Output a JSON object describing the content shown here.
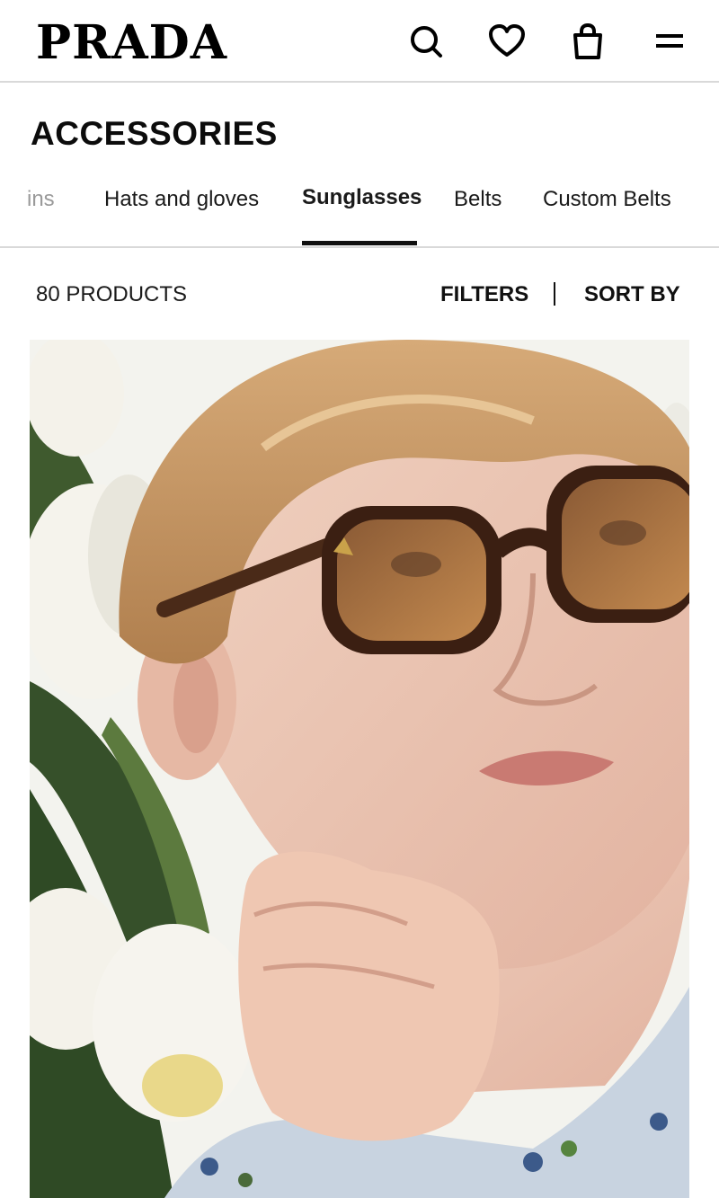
{
  "header": {
    "logo": "PRADA",
    "icons": [
      "search-icon",
      "heart-icon",
      "shopping-bag-icon",
      "menu-icon"
    ]
  },
  "category": {
    "title": "ACCESSORIES"
  },
  "tabs": [
    {
      "label": "ins",
      "state": "partially-hidden"
    },
    {
      "label": "Hats and gloves",
      "state": "default"
    },
    {
      "label": "Sunglasses",
      "state": "active"
    },
    {
      "label": "Belts",
      "state": "default"
    },
    {
      "label": "Custom Belts",
      "state": "default"
    }
  ],
  "results": {
    "count": "80 PRODUCTS",
    "filters_label": "FILTERS",
    "sort_label": "SORT BY"
  },
  "hero": {
    "subject": "model-wearing-tortoiseshell-sunglasses"
  },
  "colors": {
    "text": "#111111",
    "divider": "#d9d9d9",
    "muted_tab": "#9a9a9a"
  }
}
